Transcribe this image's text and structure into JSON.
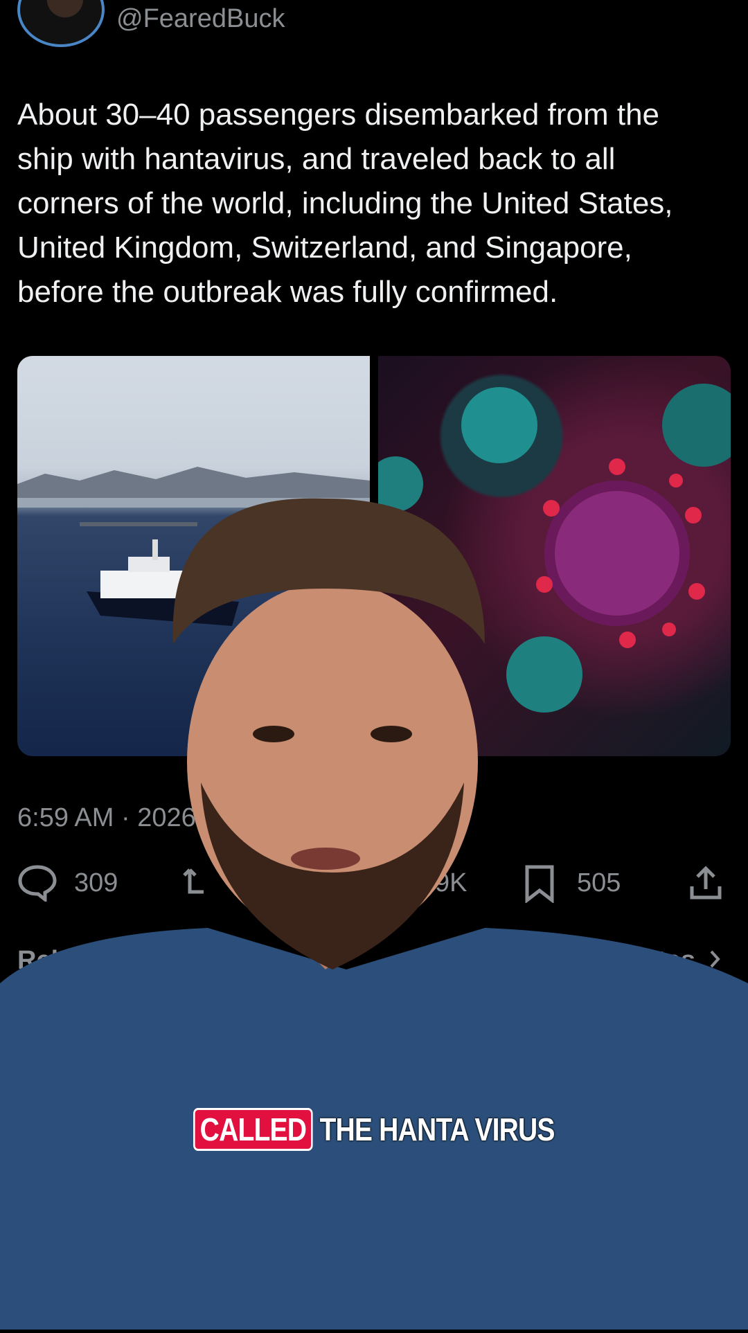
{
  "post": {
    "handle": "@FearedBuck",
    "text": "About 30–40 passengers disembarked from the\nship with hantavirus, and traveled back to all\ncorners of the world, including the United States,\nUnited Kingdom, Switzerland, and Singapore,\nbefore the outbreak was fully confirmed.",
    "timestamp": "6:59 AM · 2026-",
    "stats": {
      "replies": "309",
      "likes_partial": "9K",
      "bookmarks": "505"
    },
    "sort_label": "Relevant",
    "view_quotes_label": "View quotes"
  },
  "caption": {
    "highlight": "CALLED",
    "rest": "THE HANTA VIRUS"
  },
  "colors": {
    "background": "#000000",
    "muted_text": "#8b8f94",
    "caption_highlight": "#e2103f",
    "avatar_ring": "#4a86c5"
  },
  "icons": [
    "reply-icon",
    "retweet-icon",
    "bookmark-icon",
    "share-icon",
    "chevron-down-icon",
    "chevron-right-icon",
    "more-icon",
    "grok-icon"
  ]
}
